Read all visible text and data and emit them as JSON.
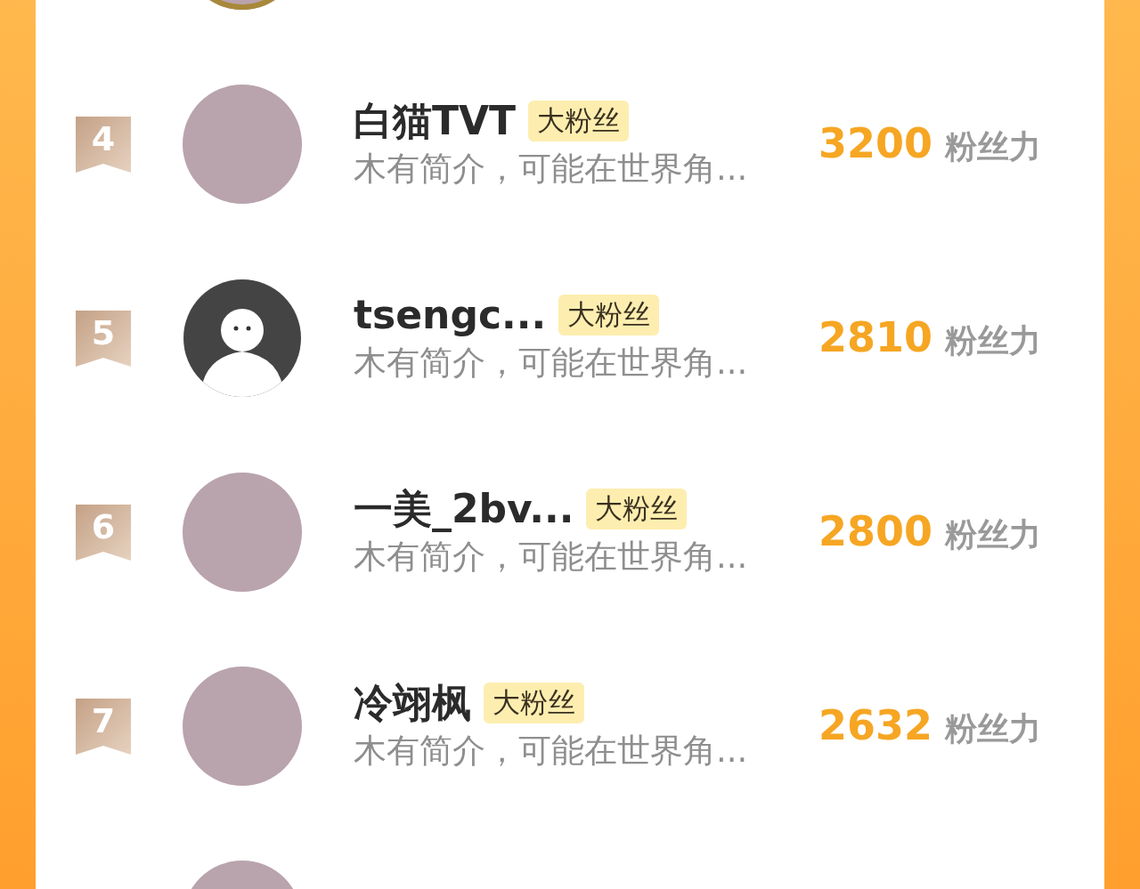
{
  "entries": [
    {
      "kind": "avatar_only",
      "avatar": {
        "kind": "photo",
        "ring": true
      }
    },
    {
      "kind": "full",
      "rank": "4",
      "avatar": {
        "kind": "photo",
        "ring": false
      },
      "name": "白猫TVT",
      "badge": "大粉丝",
      "bio": "木有简介，可能在世界角...",
      "score": "3200",
      "unit": "粉丝力"
    },
    {
      "kind": "full",
      "rank": "5",
      "avatar": {
        "kind": "silhouette",
        "ring": false
      },
      "name": "tsengc...",
      "badge": "大粉丝",
      "bio": "木有简介，可能在世界角...",
      "score": "2810",
      "unit": "粉丝力"
    },
    {
      "kind": "full",
      "rank": "6",
      "avatar": {
        "kind": "photo",
        "ring": false
      },
      "name": "一美_2bv...",
      "badge": "大粉丝",
      "bio": "木有简介，可能在世界角...",
      "score": "2800",
      "unit": "粉丝力"
    },
    {
      "kind": "full",
      "rank": "7",
      "avatar": {
        "kind": "photo",
        "ring": false
      },
      "name": "冷翊枫",
      "badge": "大粉丝",
      "bio": "木有简介，可能在世界角...",
      "score": "2632",
      "unit": "粉丝力"
    },
    {
      "kind": "avatar_only",
      "avatar": {
        "kind": "photo",
        "ring": false
      }
    }
  ]
}
